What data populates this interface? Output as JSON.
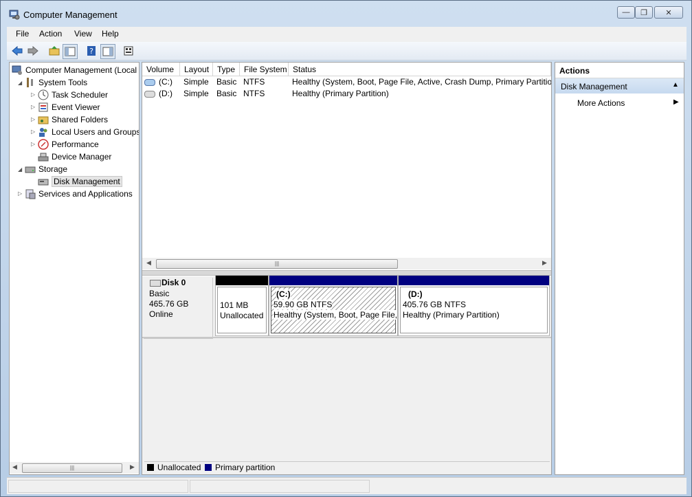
{
  "window": {
    "title": "Computer Management"
  },
  "menu": {
    "items": [
      "File",
      "Action",
      "View",
      "Help"
    ]
  },
  "tree": {
    "root": "Computer Management (Local",
    "system_tools": "System Tools",
    "task_scheduler": "Task Scheduler",
    "event_viewer": "Event Viewer",
    "shared_folders": "Shared Folders",
    "local_users": "Local Users and Groups",
    "performance": "Performance",
    "device_manager": "Device Manager",
    "storage": "Storage",
    "disk_management": "Disk Management",
    "services": "Services and Applications"
  },
  "volumes": {
    "columns": [
      "Volume",
      "Layout",
      "Type",
      "File System",
      "Status"
    ],
    "rows": [
      {
        "volume": "(C:)",
        "layout": "Simple",
        "type": "Basic",
        "fs": "NTFS",
        "status": "Healthy (System, Boot, Page File, Active, Crash Dump, Primary Partition)"
      },
      {
        "volume": "(D:)",
        "layout": "Simple",
        "type": "Basic",
        "fs": "NTFS",
        "status": "Healthy (Primary Partition)"
      }
    ]
  },
  "disk": {
    "name": "Disk 0",
    "type": "Basic",
    "size": "465.76 GB",
    "state": "Online",
    "partitions": [
      {
        "label": "",
        "size": "101 MB",
        "status": "Unallocated"
      },
      {
        "label": "(C:)",
        "size": "59.90 GB NTFS",
        "status": "Healthy (System, Boot, Page File,"
      },
      {
        "label": "(D:)",
        "size": "405.76 GB NTFS",
        "status": "Healthy (Primary Partition)"
      }
    ]
  },
  "legend": {
    "unallocated": "Unallocated",
    "primary": "Primary partition"
  },
  "actions": {
    "header": "Actions",
    "section": "Disk Management",
    "more": "More Actions"
  },
  "colors": {
    "primary_partition": "#000080",
    "unallocated": "#000000",
    "selection": "#cce8ff"
  }
}
